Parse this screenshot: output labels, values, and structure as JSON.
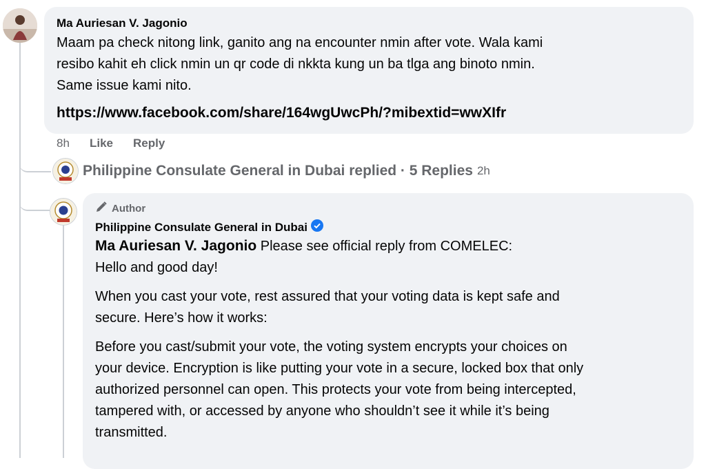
{
  "comment": {
    "author": "Ma Auriesan V. Jagonio",
    "lines": [
      "Maam pa check nitong link, ganito ang na encounter nmin after vote. Wala kami",
      "resibo kahit eh click nmin un qr code di nkkta kung un ba tlga ang binoto nmin.",
      "Same issue kami nito."
    ],
    "link": "https://www.facebook.com/share/164wgUwcPh/?mibextid=wwXIfr",
    "time": "8h",
    "like_label": "Like",
    "reply_label": "Reply"
  },
  "replies_summary": {
    "text": "Philippine Consulate General in Dubai replied · 5 Replies",
    "time": "2h"
  },
  "reply": {
    "badge": "Author",
    "author": "Philippine Consulate General in Dubai",
    "mention": "Ma Auriesan V. Jagonio",
    "intro": " Please see official reply from COMELEC:",
    "greeting": "Hello and good day!",
    "para1": [
      "When you cast your vote, rest assured that your voting data is kept safe and",
      "secure. Here’s how it works:"
    ],
    "para2": [
      "Before you cast/submit your vote, the voting system encrypts your choices on",
      "your device. Encryption is like putting your vote in a secure, locked box that only",
      "authorized personnel can open. This protects your vote from being intercepted,",
      "tampered with, or accessed by anyone who shouldn’t see it while it’s being",
      "transmitted."
    ]
  },
  "colors": {
    "bubble": "#f0f2f5",
    "meta_gray": "#65676b",
    "verified_blue": "#1877f2"
  }
}
